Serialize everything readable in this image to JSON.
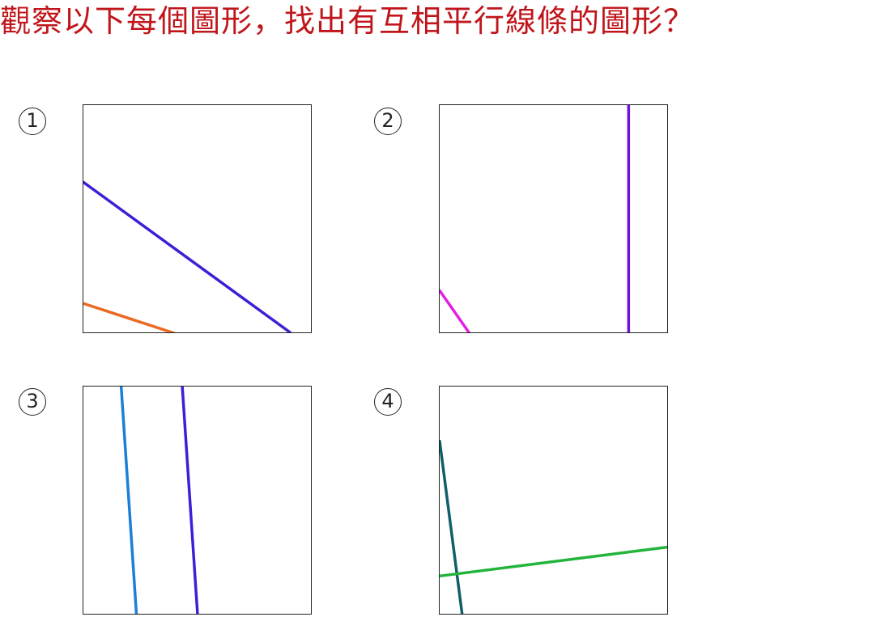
{
  "title": "觀察以下每個圖形，找出有互相平行線條的圖形？",
  "figures": [
    {
      "label": "1",
      "lines": [
        {
          "color": "#3b21d6"
        },
        {
          "color": "#ea6a24"
        }
      ]
    },
    {
      "label": "2",
      "lines": [
        {
          "color": "#e41ee0"
        },
        {
          "color": "#6c12d9"
        }
      ]
    },
    {
      "label": "3",
      "lines": [
        {
          "color": "#1b7fd8"
        },
        {
          "color": "#3b21d6"
        }
      ]
    },
    {
      "label": "4",
      "lines": [
        {
          "color": "#0f5f68"
        },
        {
          "color": "#22b43b"
        }
      ]
    }
  ]
}
